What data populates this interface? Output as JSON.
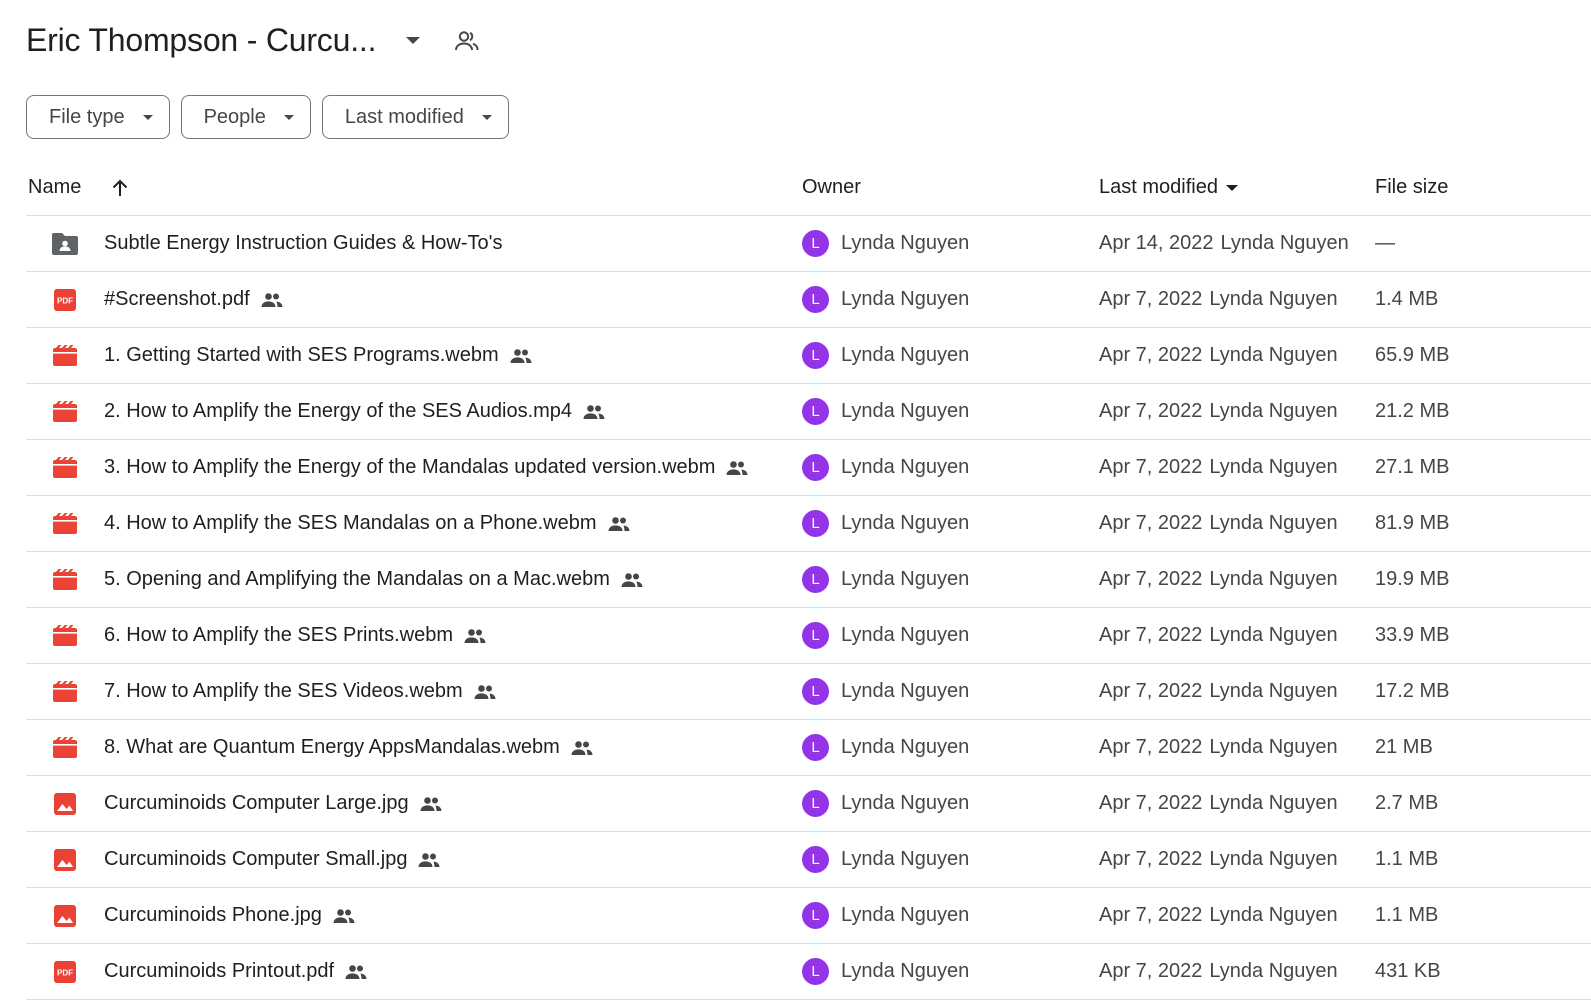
{
  "header": {
    "title": "Eric Thompson - Curcu..."
  },
  "filters": {
    "file_type": "File type",
    "people": "People",
    "last_modified": "Last modified"
  },
  "columns": {
    "name": "Name",
    "owner": "Owner",
    "last_modified": "Last modified",
    "file_size": "File size"
  },
  "colors": {
    "avatar": "#9334e6",
    "pdf_red": "#ea4335",
    "video_red": "#ea4335",
    "folder_gray": "#5f6368"
  },
  "rows": [
    {
      "icon": "shared-folder-icon",
      "name": "Subtle Energy Instruction Guides & How-To's",
      "shared": false,
      "owner_initial": "L",
      "owner": "Lynda Nguyen",
      "modified_date": "Apr 14, 2022",
      "modified_by": "Lynda Nguyen",
      "size": "—"
    },
    {
      "icon": "pdf-icon",
      "name": "#Screenshot.pdf",
      "shared": true,
      "owner_initial": "L",
      "owner": "Lynda Nguyen",
      "modified_date": "Apr 7, 2022",
      "modified_by": "Lynda Nguyen",
      "size": "1.4 MB"
    },
    {
      "icon": "video-icon",
      "name": "1. Getting Started with SES Programs.webm",
      "shared": true,
      "owner_initial": "L",
      "owner": "Lynda Nguyen",
      "modified_date": "Apr 7, 2022",
      "modified_by": "Lynda Nguyen",
      "size": "65.9 MB"
    },
    {
      "icon": "video-icon",
      "name": "2. How to Amplify the Energy of the SES Audios.mp4",
      "shared": true,
      "owner_initial": "L",
      "owner": "Lynda Nguyen",
      "modified_date": "Apr 7, 2022",
      "modified_by": "Lynda Nguyen",
      "size": "21.2 MB"
    },
    {
      "icon": "video-icon",
      "name": "3. How to Amplify the Energy of the Mandalas updated version.webm",
      "shared": true,
      "owner_initial": "L",
      "owner": "Lynda Nguyen",
      "modified_date": "Apr 7, 2022",
      "modified_by": "Lynda Nguyen",
      "size": "27.1 MB"
    },
    {
      "icon": "video-icon",
      "name": "4. How to Amplify the SES Mandalas on a Phone.webm",
      "shared": true,
      "owner_initial": "L",
      "owner": "Lynda Nguyen",
      "modified_date": "Apr 7, 2022",
      "modified_by": "Lynda Nguyen",
      "size": "81.9 MB"
    },
    {
      "icon": "video-icon",
      "name": "5. Opening and Amplifying the Mandalas on a Mac.webm",
      "shared": true,
      "owner_initial": "L",
      "owner": "Lynda Nguyen",
      "modified_date": "Apr 7, 2022",
      "modified_by": "Lynda Nguyen",
      "size": "19.9 MB"
    },
    {
      "icon": "video-icon",
      "name": "6. How to Amplify the SES Prints.webm",
      "shared": true,
      "owner_initial": "L",
      "owner": "Lynda Nguyen",
      "modified_date": "Apr 7, 2022",
      "modified_by": "Lynda Nguyen",
      "size": "33.9 MB"
    },
    {
      "icon": "video-icon",
      "name": "7. How to Amplify the SES Videos.webm",
      "shared": true,
      "owner_initial": "L",
      "owner": "Lynda Nguyen",
      "modified_date": "Apr 7, 2022",
      "modified_by": "Lynda Nguyen",
      "size": "17.2 MB"
    },
    {
      "icon": "video-icon",
      "name": "8. What are Quantum Energy AppsMandalas.webm",
      "shared": true,
      "owner_initial": "L",
      "owner": "Lynda Nguyen",
      "modified_date": "Apr 7, 2022",
      "modified_by": "Lynda Nguyen",
      "size": "21 MB"
    },
    {
      "icon": "image-icon",
      "name": "Curcuminoids Computer Large.jpg",
      "shared": true,
      "owner_initial": "L",
      "owner": "Lynda Nguyen",
      "modified_date": "Apr 7, 2022",
      "modified_by": "Lynda Nguyen",
      "size": "2.7 MB"
    },
    {
      "icon": "image-icon",
      "name": "Curcuminoids Computer Small.jpg",
      "shared": true,
      "owner_initial": "L",
      "owner": "Lynda Nguyen",
      "modified_date": "Apr 7, 2022",
      "modified_by": "Lynda Nguyen",
      "size": "1.1 MB"
    },
    {
      "icon": "image-icon",
      "name": "Curcuminoids Phone.jpg",
      "shared": true,
      "owner_initial": "L",
      "owner": "Lynda Nguyen",
      "modified_date": "Apr 7, 2022",
      "modified_by": "Lynda Nguyen",
      "size": "1.1 MB"
    },
    {
      "icon": "pdf-icon",
      "name": "Curcuminoids Printout.pdf",
      "shared": true,
      "owner_initial": "L",
      "owner": "Lynda Nguyen",
      "modified_date": "Apr 7, 2022",
      "modified_by": "Lynda Nguyen",
      "size": "431 KB"
    }
  ]
}
